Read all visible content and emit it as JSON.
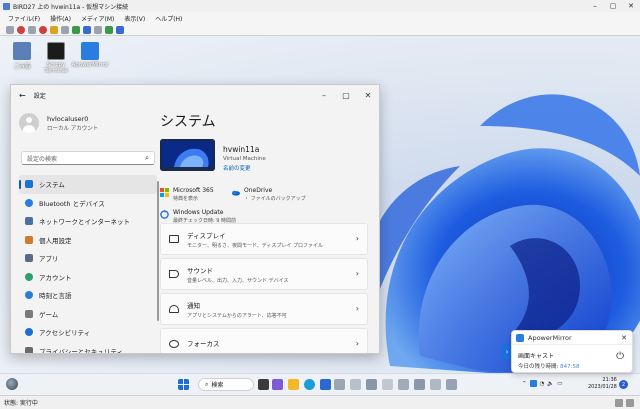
{
  "host": {
    "title": "BIRD27 上の hvwin11a - 仮想マシン接続",
    "menu": [
      "ファイル(F)",
      "操作(A)",
      "メディア(M)",
      "表示(V)",
      "ヘルプ(H)"
    ],
    "status": "状態: 実行中"
  },
  "desktop": {
    "icons": [
      {
        "label": "ごみ箱",
        "color": "#5b7fb8"
      },
      {
        "label": "Scrcpy Terminal",
        "color": "#1b1b1b"
      },
      {
        "label": "ApowerMirror",
        "color": "#2a7de0"
      }
    ]
  },
  "settings": {
    "window_title": "設定",
    "user": {
      "name": "hvlocaluser0",
      "type": "ローカル アカウント"
    },
    "search_placeholder": "設定の検索",
    "nav": [
      {
        "label": "システム",
        "icon": "monitor-icon",
        "color": "#1f6fd1",
        "active": true
      },
      {
        "label": "Bluetooth とデバイス",
        "icon": "bluetooth-icon",
        "color": "#2a7de0"
      },
      {
        "label": "ネットワークとインターネット",
        "icon": "network-icon",
        "color": "#4c6fa0"
      },
      {
        "label": "個人用設定",
        "icon": "brush-icon",
        "color": "#d07a30"
      },
      {
        "label": "アプリ",
        "icon": "apps-icon",
        "color": "#5a6b88"
      },
      {
        "label": "アカウント",
        "icon": "account-icon",
        "color": "#2aa070"
      },
      {
        "label": "時刻と言語",
        "icon": "clock-globe-icon",
        "color": "#2a80d0"
      },
      {
        "label": "ゲーム",
        "icon": "gamepad-icon",
        "color": "#7a7a7a"
      },
      {
        "label": "アクセシビリティ",
        "icon": "accessibility-icon",
        "color": "#1f6fd1"
      },
      {
        "label": "プライバシーとセキュリティ",
        "icon": "shield-icon",
        "color": "#6a6a6a"
      }
    ],
    "page_title": "システム",
    "device": {
      "name": "hvwin11a",
      "type": "Virtual Machine",
      "rename": "名前の変更"
    },
    "quick": [
      {
        "title": "Microsoft 365",
        "desc": "特典を表示",
        "icon": "microsoft-icon"
      },
      {
        "title": "OneDrive",
        "desc": "・ ファイルのバックアップ",
        "icon": "onedrive-icon"
      },
      {
        "title": "Windows Update",
        "desc": "最終チェック日時: 9 時間前",
        "icon": "windows-update-icon"
      }
    ],
    "cards": [
      {
        "title": "ディスプレイ",
        "desc": "モニター、明るさ、夜間モード、ディスプレイ プロファイル",
        "icon": "display-icon"
      },
      {
        "title": "サウンド",
        "desc": "音量レベル、出力、入力、サウンド デバイス",
        "icon": "speaker-icon"
      },
      {
        "title": "通知",
        "desc": "アプリとシステムからのアラート、応答不可",
        "icon": "bell-icon"
      },
      {
        "title": "フォーカス",
        "desc": "",
        "icon": "focus-icon"
      }
    ]
  },
  "taskbar": {
    "search_label": "検索",
    "clock_time": "21:36",
    "clock_date": "2023/01/28",
    "notification_count": "2"
  },
  "apower": {
    "app_name": "ApowerMirror",
    "line1": "画面キャスト",
    "line2_label": "今日の残り時間:",
    "line2_value": "847:58"
  }
}
